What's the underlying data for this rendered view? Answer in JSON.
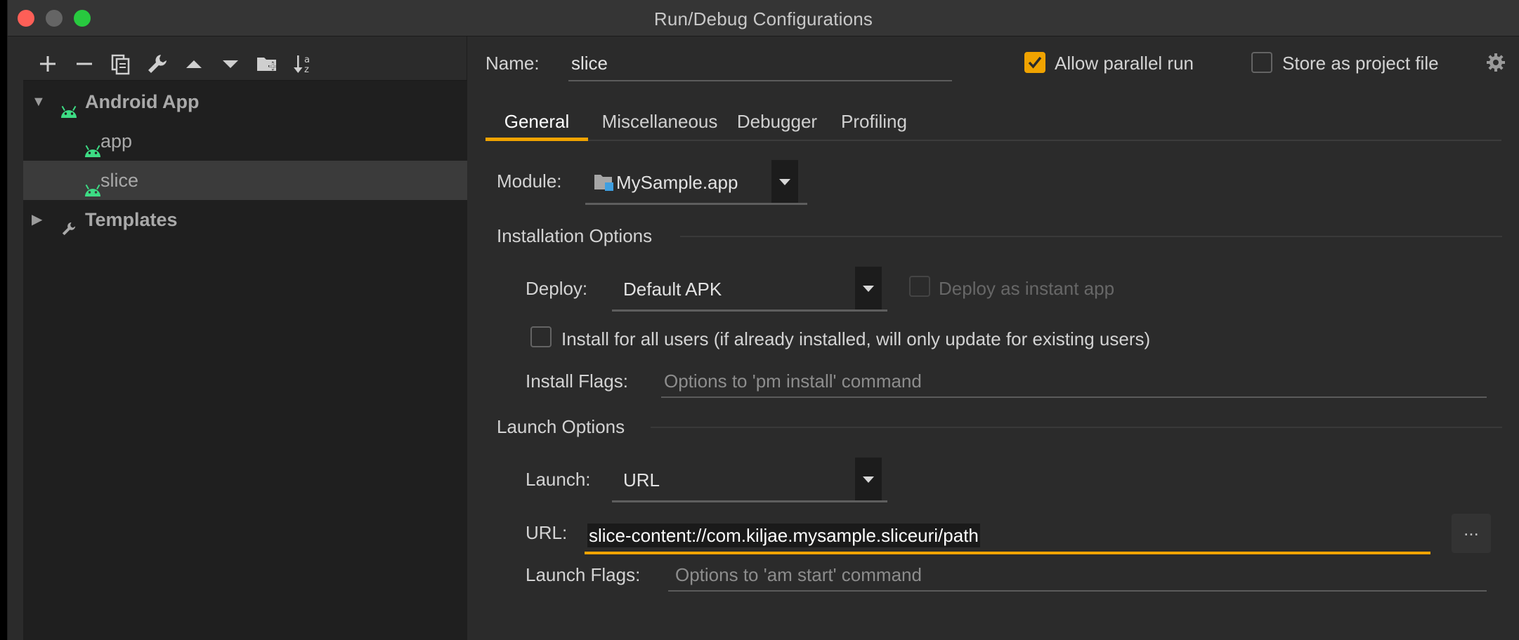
{
  "window": {
    "title": "Run/Debug Configurations"
  },
  "toolbar": {
    "icons": [
      "add-icon",
      "remove-icon",
      "copy-icon",
      "wrench-icon",
      "move-up-icon",
      "move-down-icon",
      "new-folder-icon",
      "sort-icon"
    ]
  },
  "tree": {
    "items": [
      {
        "label": "Android App",
        "expanded": true,
        "icon": "android-icon"
      },
      {
        "label": "app",
        "icon": "android-icon"
      },
      {
        "label": "slice",
        "icon": "android-icon",
        "selected": true
      },
      {
        "label": "Templates",
        "expanded": false,
        "icon": "wrench-icon"
      }
    ]
  },
  "header": {
    "name_label": "Name:",
    "name_value": "slice",
    "allow_parallel_run": "Allow parallel run",
    "allow_parallel_checked": true,
    "store_as_project_file": "Store as project file",
    "store_checked": false
  },
  "tabs": [
    {
      "label": "General",
      "active": true
    },
    {
      "label": "Miscellaneous"
    },
    {
      "label": "Debugger"
    },
    {
      "label": "Profiling"
    }
  ],
  "general": {
    "module_label": "Module:",
    "module_value": "MySample.app",
    "installation_options": "Installation Options",
    "deploy_label": "Deploy:",
    "deploy_value": "Default APK",
    "deploy_instant": "Deploy as instant app",
    "install_all_users": "Install for all users (if already installed, will only update for existing users)",
    "install_flags_label": "Install Flags:",
    "install_flags_placeholder": "Options to 'pm install' command",
    "launch_options": "Launch Options",
    "launch_label": "Launch:",
    "launch_value": "URL",
    "url_label": "URL:",
    "url_value": "slice-content://com.kiljae.mysample.sliceuri/path",
    "browse_label": "...",
    "launch_flags_label": "Launch Flags:",
    "launch_flags_placeholder": "Options to 'am start' command"
  },
  "colors": {
    "accent": "#f0a300",
    "android_green": "#3ddc84",
    "background": "#2b2b2b",
    "tree_background": "#1f1f1f",
    "selected_row": "#3b3b3b"
  }
}
